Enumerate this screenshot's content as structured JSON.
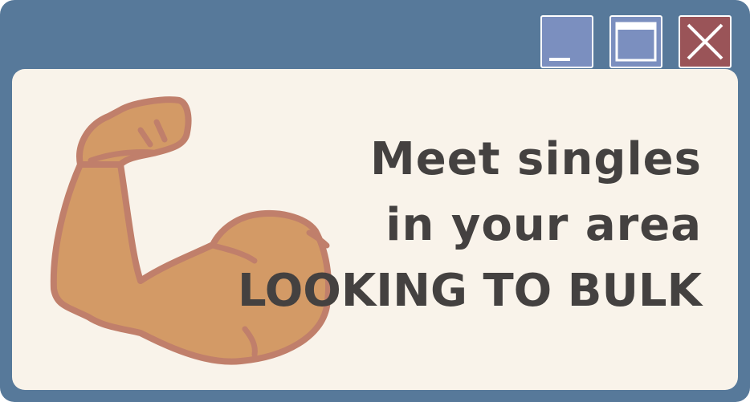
{
  "window": {
    "controls": {
      "minimize_icon": "minimize-icon",
      "maximize_icon": "maximize-icon",
      "close_icon": "close-icon"
    },
    "colors": {
      "frame": "#57799a",
      "content_bg": "#f9f3ea",
      "min_max_button": "#7b8fbf",
      "close_button": "#9a5458",
      "text": "#444140",
      "arm_fill": "#d39a66",
      "arm_outline": "#c07f6b"
    }
  },
  "ad": {
    "illustration_icon": "flexed-biceps-icon",
    "line1": "Meet singles",
    "line2": "in your area",
    "line3": "LOOKING TO BULK"
  }
}
